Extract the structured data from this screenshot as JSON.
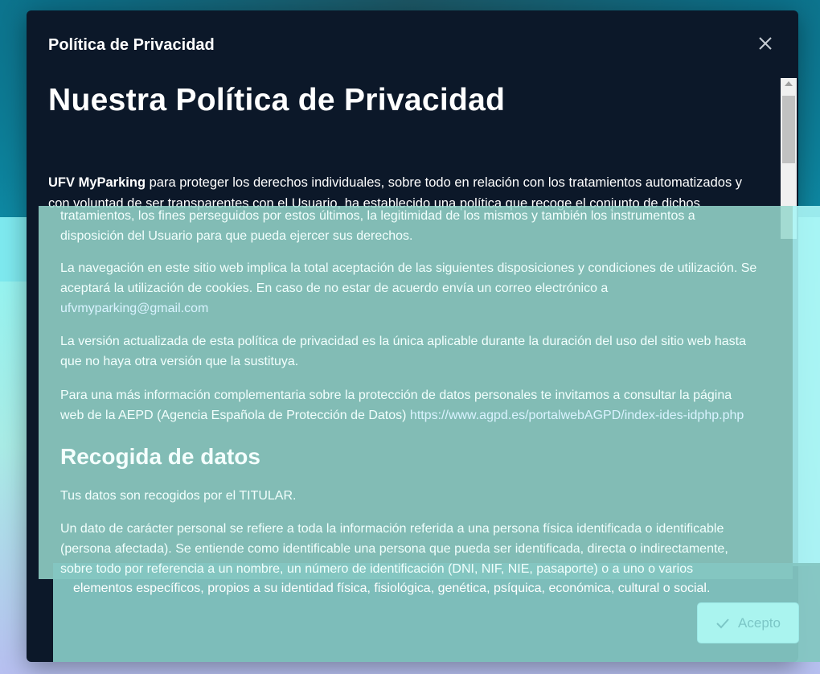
{
  "modal": {
    "title": "Política de Privacidad",
    "close_icon": "close-icon",
    "heading": "Nuestra Política de Privacidad",
    "intro_brand": "UFV MyParking",
    "intro_line1": " para proteger los derechos individuales, sobre todo en relación con los tratamientos automatizados y",
    "intro_line2": "con voluntad de ser transparentes con el Usuario, ha establecido una política que recoge el conjunto de dichos",
    "intro_line3": "tratamientos, los fines perseguidos por estos últimos, la legitimidad de los mismos y también los instrumentos a",
    "intro_line4": "disposición del Usuario para que pueda ejercer sus derechos.",
    "para2_line1": "La navegación en este sitio web implica la total aceptación de las siguientes disposiciones y condiciones de utilización. Se",
    "para2_line2": "aceptará la utilización de cookies. En caso de no estar de acuerdo envía un correo electrónico a",
    "para2_email": "ufvmyparking@gmail.com",
    "para3_line1": "La versión actualizada de esta política de privacidad es la única aplicable durante la duración del uso del sitio web hasta",
    "para3_line2": "que no haya otra versión que la sustituya.",
    "para4_line1": "Para una más información complementaria sobre la protección de datos personales te invitamos a consultar la página",
    "para4_line2": "web de la AEPD (Agencia Española de Protección de Datos) ",
    "para4_link": "https://www.agpd.es/portalwebAGPD/index-ides-idphp.php",
    "section_heading": "Recogida de datos",
    "para5": "Tus datos son recogidos por el TITULAR.",
    "para6_line1": "Un dato de carácter personal se refiere a toda la información referida a una persona física identificada o identificable",
    "para6_line2": "(persona afectada). Se entiende como identificable una persona que pueda ser identificada, directa o indirectamente,",
    "para6_line3": "sobre todo por referencia a un nombre, un número de identificación (DNI, NIF, NIE, pasaporte) o a uno o varios",
    "para6_line4": "elementos específicos, propios a su identidad física, fisiológica, genética, psíquica, económica, cultural o social.",
    "accept_label": "Acepto",
    "accept_icon": "check-icon"
  }
}
